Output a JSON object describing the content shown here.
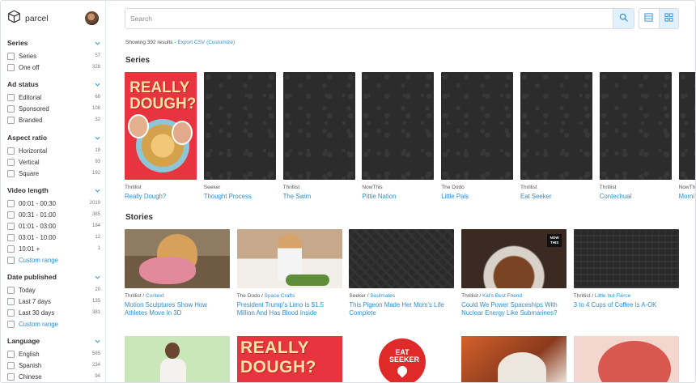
{
  "app": {
    "name": "parcel"
  },
  "sidebar": {
    "sections": [
      {
        "title": "Series",
        "options": [
          {
            "label": "Series",
            "count": "57"
          },
          {
            "label": "One off",
            "count": "328"
          }
        ]
      },
      {
        "title": "Ad status",
        "options": [
          {
            "label": "Editorial",
            "count": "68"
          },
          {
            "label": "Sponsored",
            "count": "108"
          },
          {
            "label": "Branded",
            "count": "32"
          }
        ]
      },
      {
        "title": "Aspect ratio",
        "options": [
          {
            "label": "Horizontal",
            "count": "19"
          },
          {
            "label": "Vertical",
            "count": "93"
          },
          {
            "label": "Square",
            "count": "192"
          }
        ]
      },
      {
        "title": "Video length",
        "options": [
          {
            "label": "00:01 - 00:30",
            "count": "2019"
          },
          {
            "label": "00:31 - 01:00",
            "count": "385"
          },
          {
            "label": "01:01 - 03:00",
            "count": "184"
          },
          {
            "label": "03:01 - 10:00",
            "count": "12"
          },
          {
            "label": "10:01 +",
            "count": "1"
          }
        ],
        "custom_range": "Custom range"
      },
      {
        "title": "Date published",
        "options": [
          {
            "label": "Today",
            "count": "20"
          },
          {
            "label": "Last 7 days",
            "count": "135"
          },
          {
            "label": "Last 30 days",
            "count": "381"
          }
        ],
        "custom_range": "Custom range"
      },
      {
        "title": "Language",
        "options": [
          {
            "label": "English",
            "count": "585"
          },
          {
            "label": "Spanish",
            "count": "234"
          },
          {
            "label": "Chinese",
            "count": "94"
          }
        ]
      }
    ]
  },
  "search": {
    "placeholder": "Search",
    "value": ""
  },
  "results": {
    "text": "Showing 392 results - ",
    "export": "Export CSV (Customize)"
  },
  "series": {
    "heading": "Series",
    "cover_text": "REALLY DOUGH?",
    "items": [
      {
        "publisher": "Thrillist",
        "title": "Really Dough?"
      },
      {
        "publisher": "Seeker",
        "title": "Thought Process"
      },
      {
        "publisher": "Thrillist",
        "title": "The Swim"
      },
      {
        "publisher": "NowThis",
        "title": "Pittie Nation"
      },
      {
        "publisher": "The Dodo",
        "title": "Little Pals"
      },
      {
        "publisher": "Thrillist",
        "title": "Eat Seeker"
      },
      {
        "publisher": "Thrillist",
        "title": "Contechual"
      },
      {
        "publisher": "NowThis",
        "title": "Morni"
      }
    ]
  },
  "stories": {
    "heading": "Stories",
    "nowthis_badge": "NOW THIS",
    "items": [
      {
        "publisher": "Thrillist",
        "sub": "Context",
        "title": "Motion Sculptures Show How Athletes Move In 3D"
      },
      {
        "publisher": "The Dodo",
        "sub": "Space Crafts",
        "title": "President Trump's Limo Is $1.5 Million And Has Blood Inside"
      },
      {
        "publisher": "Seeker",
        "sub": "Soulmates",
        "title": "This Pigeon Made Her Mom's Life Complete"
      },
      {
        "publisher": "Thrillist",
        "sub": "Kid's Best Friend",
        "title": "Could We Power Spaceships With Nuclear Energy Like Submarines?"
      },
      {
        "publisher": "Thrillist",
        "sub": "Little but Fierce",
        "title": "3 to 4 Cups of Coffee Is A-OK"
      }
    ]
  },
  "bottom_row": {
    "really_dough": "REALLY DOUGH?",
    "eat_seeker": "EAT SEEKER"
  }
}
